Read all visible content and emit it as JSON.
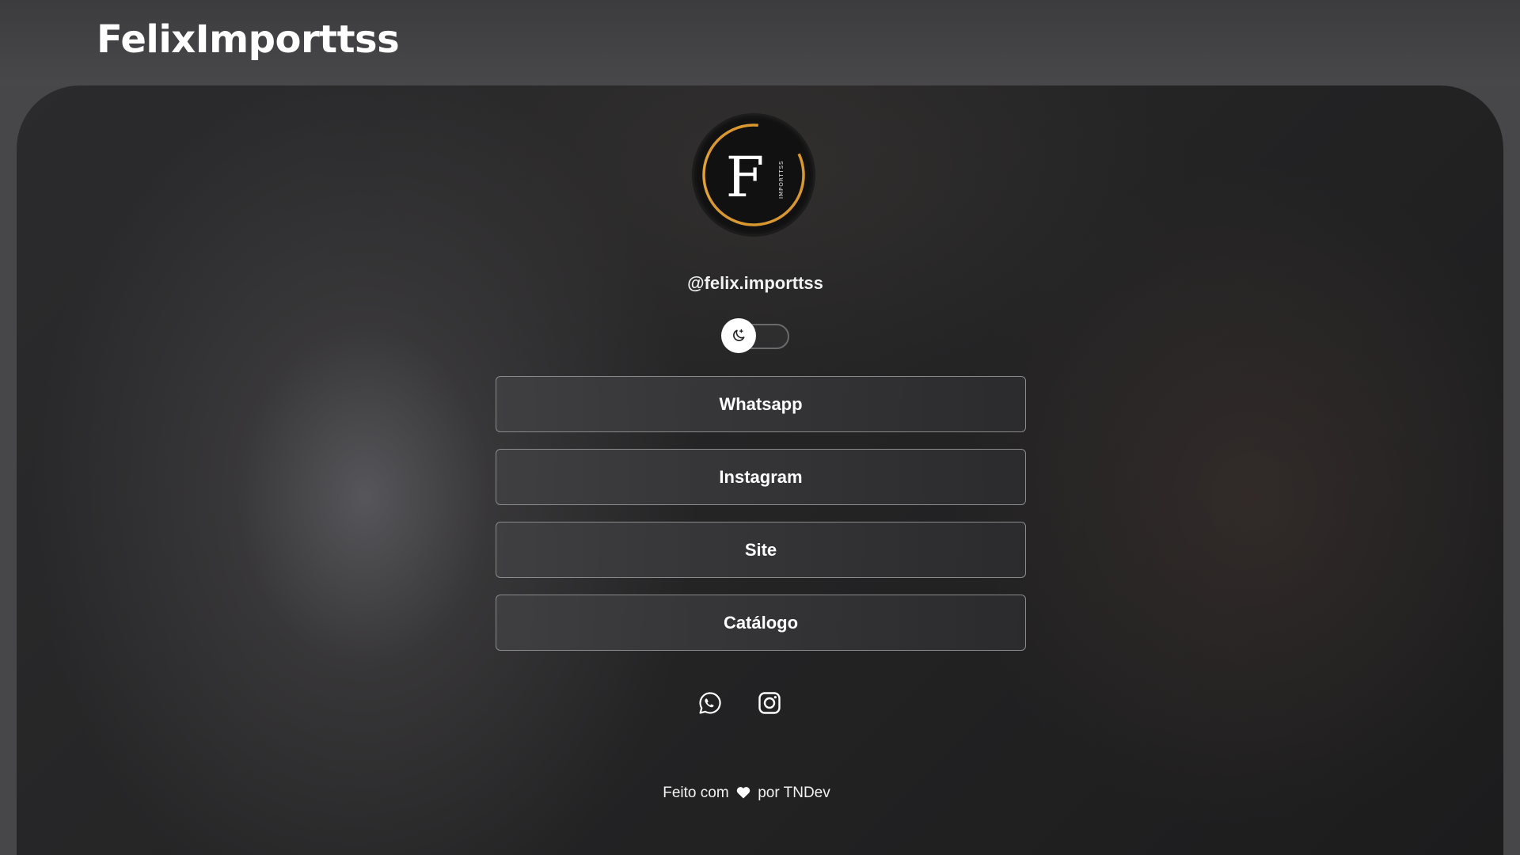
{
  "header": {
    "site_title": "FelixImporttss"
  },
  "profile": {
    "logo_letter": "F",
    "logo_side_text": "IMPORTTSS",
    "handle": "@felix.importtss",
    "avatar_ring_color": "#d9982f"
  },
  "theme_toggle": {
    "icon": "moon-icon",
    "state": "off"
  },
  "links": [
    {
      "label": "Whatsapp"
    },
    {
      "label": "Instagram"
    },
    {
      "label": "Site"
    },
    {
      "label": "Catálogo"
    }
  ],
  "social_icons": [
    {
      "icon": "whatsapp-icon"
    },
    {
      "icon": "instagram-icon"
    }
  ],
  "footer": {
    "prefix": "Feito com",
    "heart_icon": "heart-icon",
    "suffix": "por TNDev"
  },
  "colors": {
    "text": "#ffffff",
    "button_border": "#8a8a8c",
    "accent_gold": "#d9982f"
  }
}
